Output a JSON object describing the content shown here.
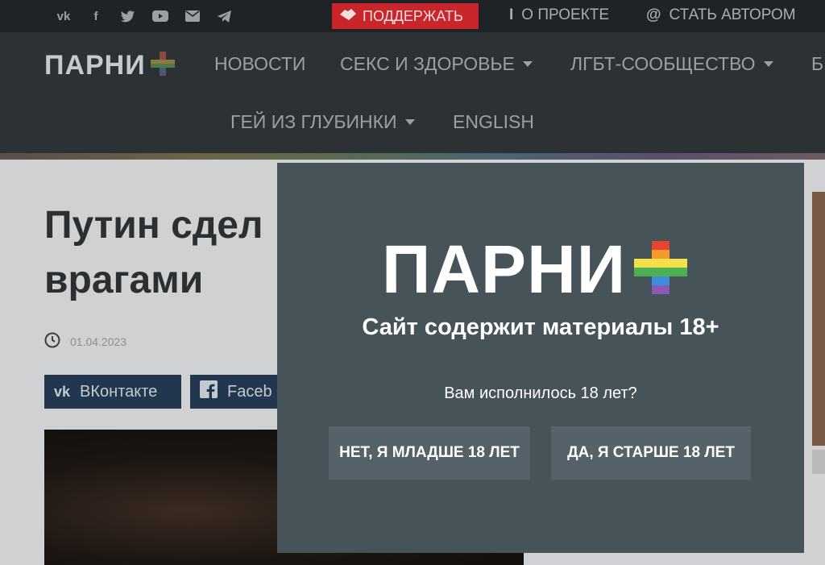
{
  "topbar": {
    "social_icons": [
      "vk-icon",
      "facebook-icon",
      "twitter-icon",
      "youtube-icon",
      "mail-icon",
      "telegram-icon"
    ],
    "support_label": "ПОДДЕРЖАТЬ",
    "about_label": "О ПРОЕКТЕ",
    "author_label": "СТАТЬ АВТОРОМ"
  },
  "header": {
    "brand": "ПАРНИ",
    "menu": {
      "news": "НОВОСТИ",
      "sex_health": "СЕКС И ЗДОРОВЬЕ",
      "lgbt": "ЛГБТ-СООБЩЕСТВО",
      "more": "Б",
      "gay_outback": "ГЕЙ ИЗ ГЛУБИНКИ",
      "english": "ENGLISH"
    }
  },
  "article": {
    "title_line1": "Путин сдел",
    "title_line2": "врагами",
    "date": "01.04.2023",
    "share_vk": "ВКонтакте",
    "share_fb": "Faceb"
  },
  "modal": {
    "logo": "ПАРНИ",
    "heading": "Сайт содержит материалы 18+",
    "question": "Вам исполнилось 18 лет?",
    "no_button": "НЕТ, Я МЛАДШЕ 18 ЛЕТ",
    "yes_button": "ДА, Я СТАРШЕ 18 ЛЕТ"
  },
  "colors": {
    "accent_red": "#c9262b",
    "modal_bg": "#465359",
    "button_bg": "#55626a",
    "share_bg": "#23364f"
  }
}
